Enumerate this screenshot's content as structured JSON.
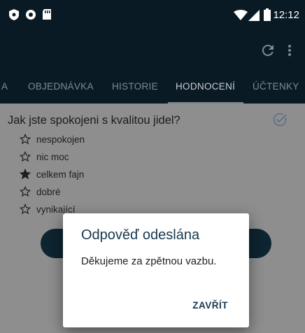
{
  "status": {
    "time": "12:12"
  },
  "tabs": [
    {
      "label": "A"
    },
    {
      "label": "OBJEDNÁVKA"
    },
    {
      "label": "HISTORIE"
    },
    {
      "label": "HODNOCENÍ"
    },
    {
      "label": "ÚČTENKY"
    }
  ],
  "rating": {
    "question": "Jak jste spokojeni s kvalitou jidel?",
    "options": [
      {
        "label": "nespokojen",
        "selected": false
      },
      {
        "label": "nic moc",
        "selected": false
      },
      {
        "label": "celkem fajn",
        "selected": true
      },
      {
        "label": "dobré",
        "selected": false
      },
      {
        "label": "vynikající",
        "selected": false
      }
    ]
  },
  "dialog": {
    "title": "Odpověď odeslána",
    "message": "Děkujeme za zpětnou vazbu.",
    "close_label": "ZAVŘÍT"
  },
  "colors": {
    "appbar": "#0a1a24",
    "accent": "#17384f",
    "scrim": "#8e8e8e"
  },
  "icons": [
    "shield-icon",
    "circle-icon",
    "sd-card-icon",
    "wifi-icon",
    "signal-icon",
    "battery-icon",
    "refresh-icon",
    "more-vert-icon",
    "check-circle-icon",
    "star-outline-icon",
    "star-filled-icon"
  ]
}
